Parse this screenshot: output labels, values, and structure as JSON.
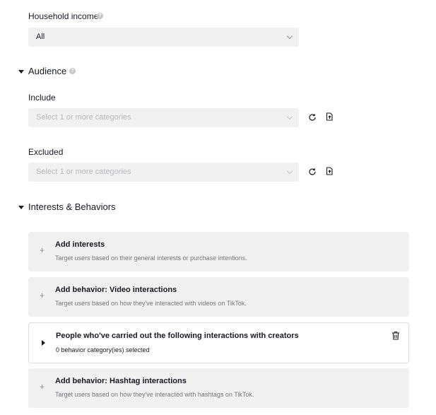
{
  "household_income": {
    "label": "Household income",
    "value": "All"
  },
  "audience": {
    "title": "Audience",
    "include": {
      "label": "Include",
      "placeholder": "Select 1 or more categories"
    },
    "excluded": {
      "label": "Excluded",
      "placeholder": "Select 1 or more categories"
    }
  },
  "interests_behaviors": {
    "title": "Interests & Behaviors",
    "cards": [
      {
        "title": "Add interests",
        "desc": "Target users based on their general interests or purchase intentions."
      },
      {
        "title": "Add behavior: Video interactions",
        "desc": "Target users based on how they've interacted with videos on TikTok."
      },
      {
        "title": "People who've carried out the following interactions with creators",
        "desc": "0 behavior category(ies) selected"
      },
      {
        "title": "Add behavior: Hashtag interactions",
        "desc": "Target users based on how they've interacted with hashtags on TikTok."
      }
    ]
  },
  "icons": {
    "help": "?",
    "plus": "+"
  },
  "colors": {
    "field_bg": "#f1f1f2",
    "placeholder": "#b8b9bd",
    "text": "#161823"
  }
}
